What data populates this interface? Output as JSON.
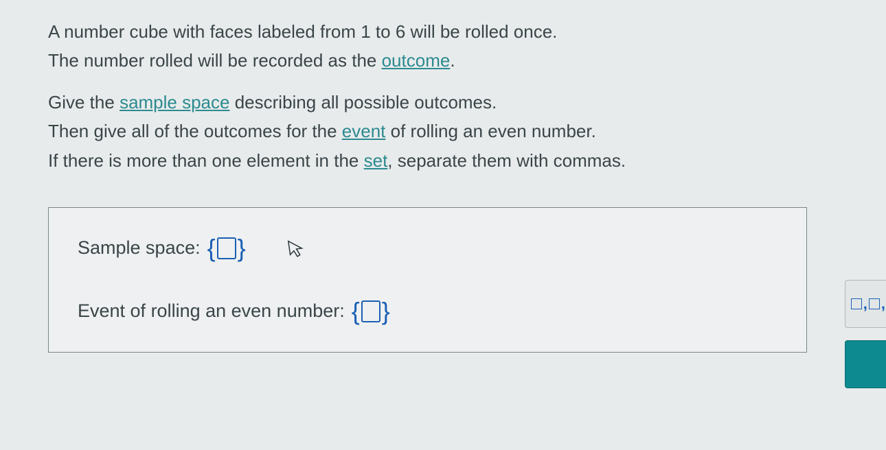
{
  "problem": {
    "line1_a": "A number cube with faces labeled from 1 to 6 will be rolled once.",
    "line2_a": "The number rolled will be recorded as the ",
    "line2_term": "outcome",
    "line2_b": ".",
    "line3_a": "Give the ",
    "line3_term": "sample space",
    "line3_b": " describing all possible outcomes.",
    "line4_a": "Then give all of the outcomes for the ",
    "line4_term": "event",
    "line4_b": " of rolling an even number.",
    "line5_a": "If there is more than one element in the ",
    "line5_term": "set",
    "line5_b": ", separate them with commas."
  },
  "answers": {
    "sample_space_label": "Sample space:",
    "event_label": "Event of rolling an even number:",
    "sample_space_value": "",
    "event_value": ""
  },
  "toolbar": {
    "comma_button_hint": "□,□,"
  }
}
